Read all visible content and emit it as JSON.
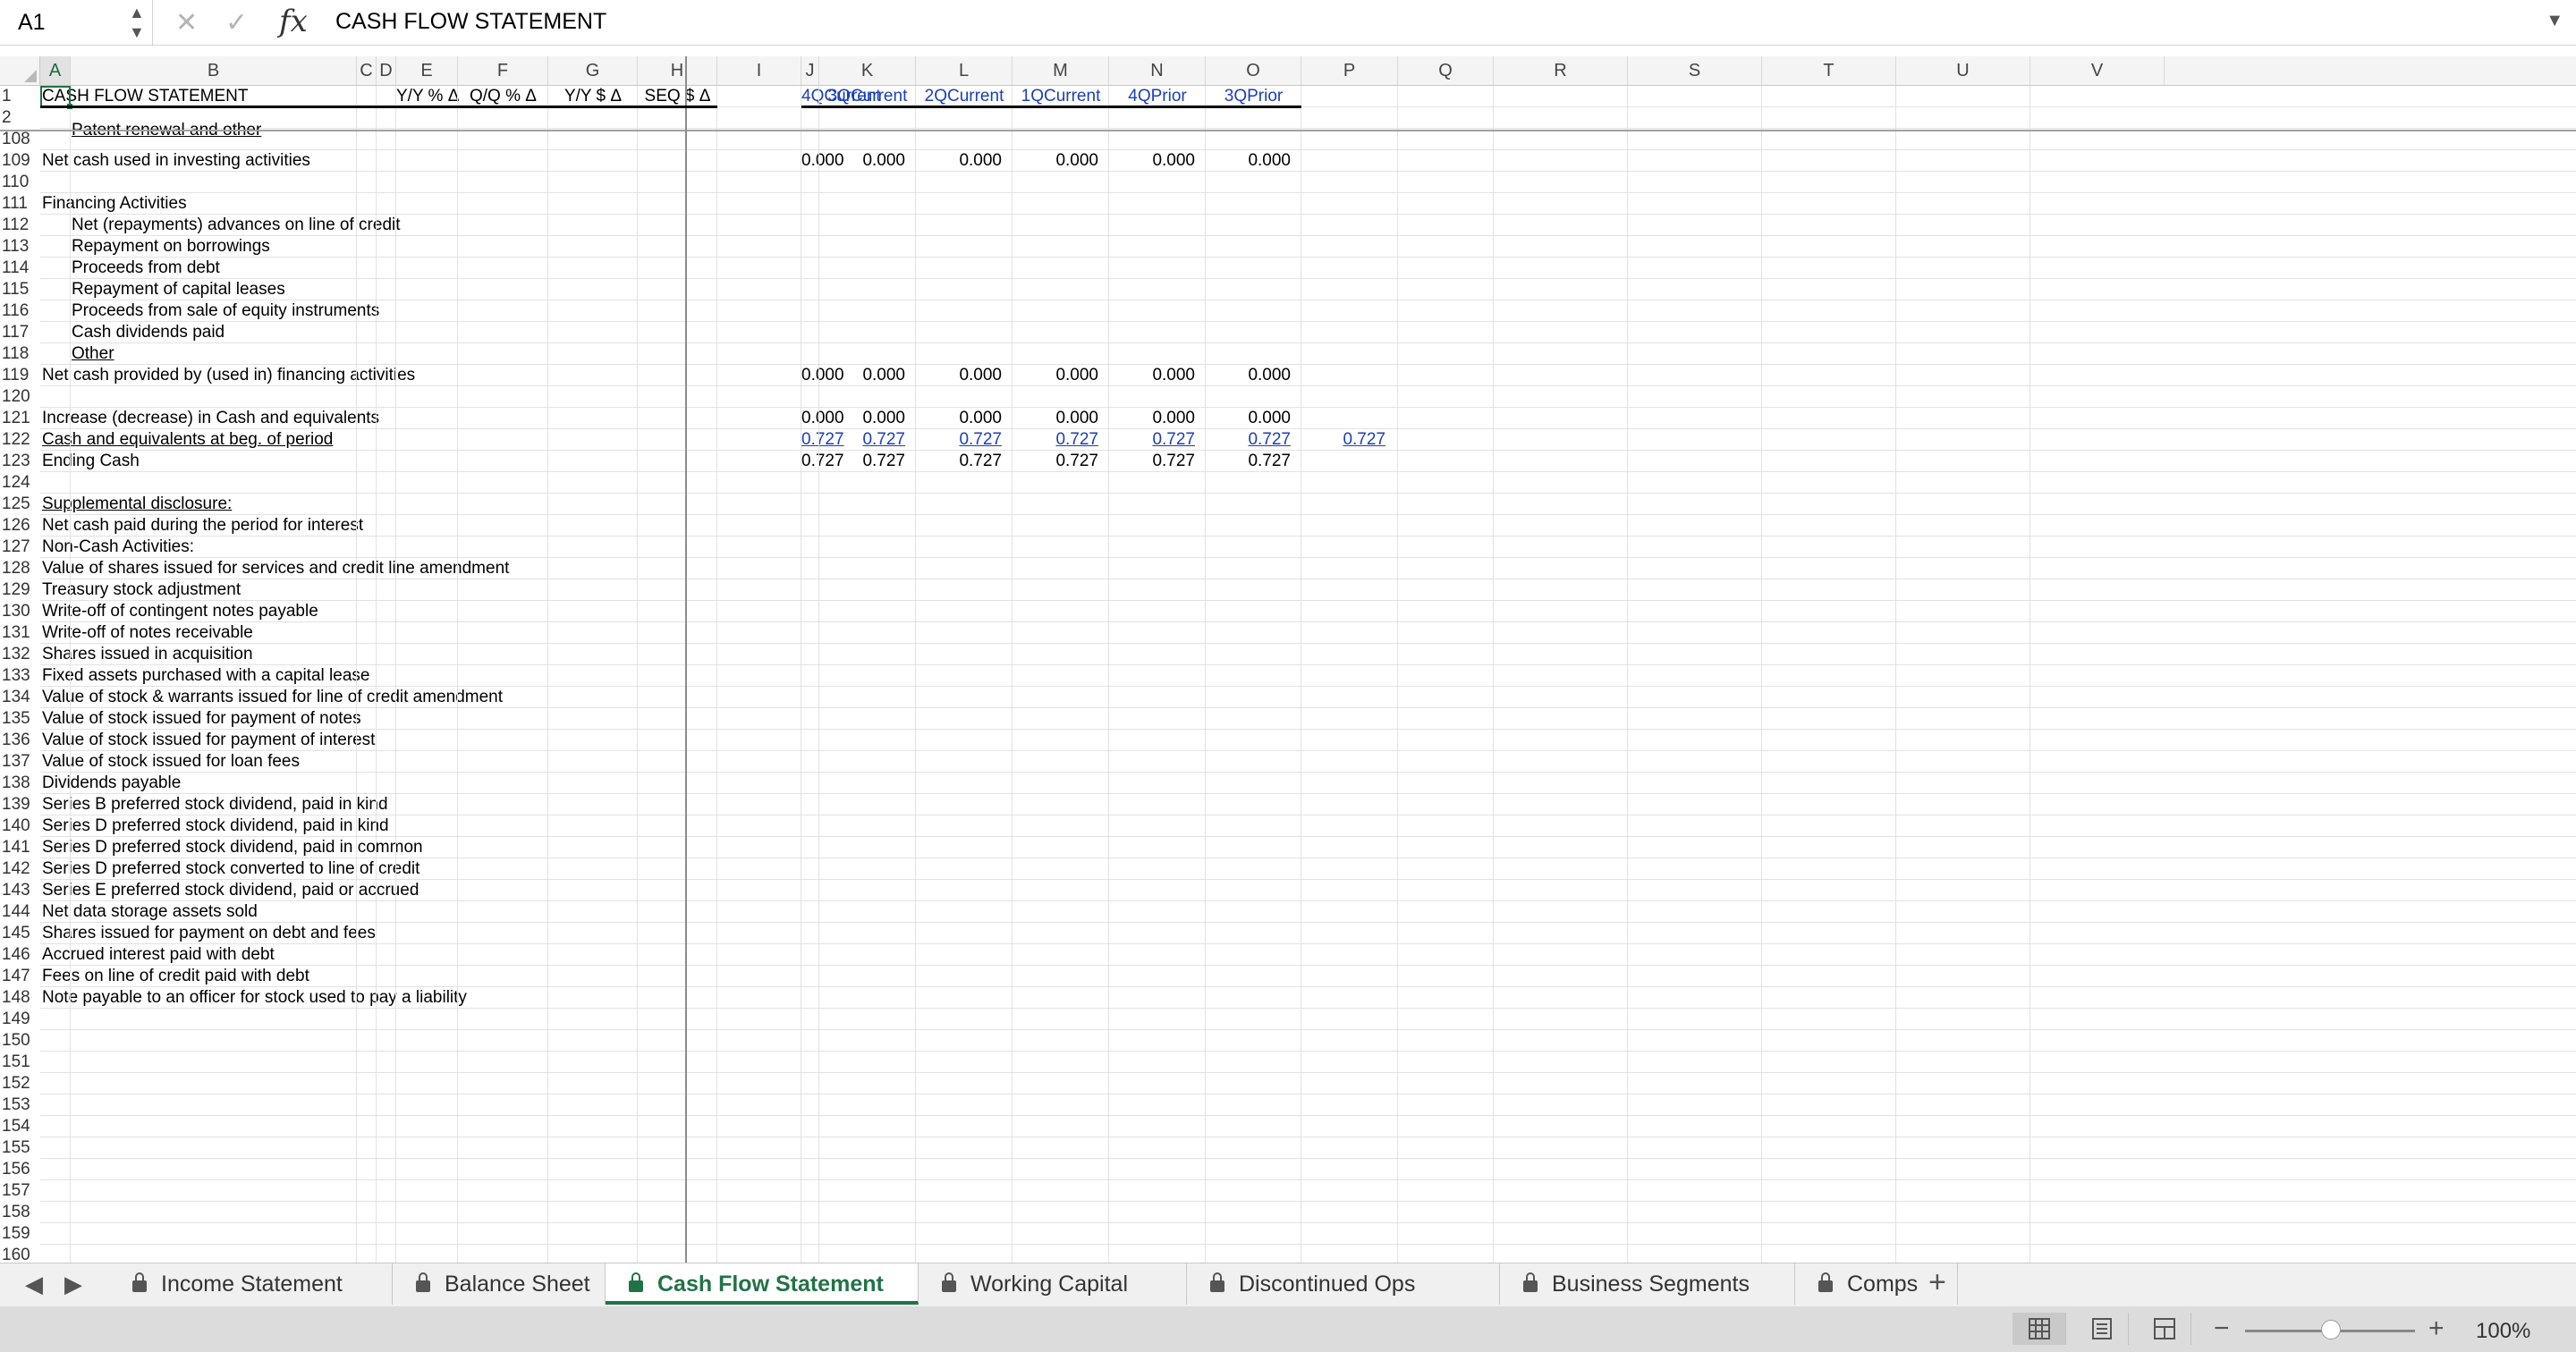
{
  "formula_bar": {
    "name_box": "A1",
    "fx": "fx",
    "formula": "CASH FLOW STATEMENT"
  },
  "column_headers": [
    "A",
    "B",
    "C",
    "D",
    "E",
    "F",
    "G",
    "H",
    "I",
    "J",
    "K",
    "L",
    "M",
    "N",
    "O",
    "P",
    "Q",
    "R",
    "S",
    "T",
    "U",
    "V"
  ],
  "header_row": {
    "title": "CASH FLOW STATEMENT",
    "e": "Y/Y % Δ",
    "f": "Q/Q % Δ",
    "g": "Y/Y $ Δ",
    "h": "SEQ $ Δ",
    "j": "4QCurrent",
    "k": "3QCurrent",
    "l": "2QCurrent",
    "m": "1QCurrent",
    "n": "4QPrior",
    "o": "3QPrior"
  },
  "rows": [
    {
      "n": "1",
      "label": ""
    },
    {
      "n": "2",
      "label": ""
    },
    {
      "n": "108",
      "label": "Patent renewal and other"
    },
    {
      "n": "109",
      "label": "Net cash used in investing activities",
      "vals": [
        "0.000",
        "0.000",
        "0.000",
        "0.000",
        "0.000",
        "0.000"
      ]
    },
    {
      "n": "110",
      "label": ""
    },
    {
      "n": "111",
      "label": "Financing Activities"
    },
    {
      "n": "112",
      "label": "Net (repayments) advances on line of credit",
      "indent": true
    },
    {
      "n": "113",
      "label": "Repayment on borrowings",
      "indent": true
    },
    {
      "n": "114",
      "label": "Proceeds from debt",
      "indent": true
    },
    {
      "n": "115",
      "label": "Repayment of capital leases",
      "indent": true
    },
    {
      "n": "116",
      "label": "Proceeds from sale of equity instruments",
      "indent": true
    },
    {
      "n": "117",
      "label": "Cash dividends paid",
      "indent": true
    },
    {
      "n": "118",
      "label": "Other",
      "indent": true,
      "underline": true
    },
    {
      "n": "119",
      "label": "Net cash provided by (used in) financing activities",
      "vals": [
        "0.000",
        "0.000",
        "0.000",
        "0.000",
        "0.000",
        "0.000"
      ]
    },
    {
      "n": "120",
      "label": ""
    },
    {
      "n": "121",
      "label": "Increase (decrease) in Cash and equivalents",
      "vals": [
        "0.000",
        "0.000",
        "0.000",
        "0.000",
        "0.000",
        "0.000"
      ]
    },
    {
      "n": "122",
      "label": "Cash and equivalents at beg. of period",
      "underline": true,
      "link": true,
      "vals": [
        "0.727",
        "0.727",
        "0.727",
        "0.727",
        "0.727",
        "0.727"
      ],
      "p": "0.727"
    },
    {
      "n": "123",
      "label": "Ending Cash",
      "vals": [
        "0.727",
        "0.727",
        "0.727",
        "0.727",
        "0.727",
        "0.727"
      ]
    },
    {
      "n": "124",
      "label": ""
    },
    {
      "n": "125",
      "label": "Supplemental disclosure:",
      "underline": true
    },
    {
      "n": "126",
      "label": "Net cash paid during the period for interest"
    },
    {
      "n": "127",
      "label": "Non-Cash Activities:"
    },
    {
      "n": "128",
      "label": "Value of shares issued for services and credit line amendment"
    },
    {
      "n": "129",
      "label": "Treasury stock adjustment"
    },
    {
      "n": "130",
      "label": "Write-off of contingent notes payable"
    },
    {
      "n": "131",
      "label": "Write-off of notes receivable"
    },
    {
      "n": "132",
      "label": "Shares issued in acquisition"
    },
    {
      "n": "133",
      "label": "Fixed assets purchased with a capital lease"
    },
    {
      "n": "134",
      "label": "Value of stock & warrants issued for line of credit amendment"
    },
    {
      "n": "135",
      "label": "Value of stock issued for payment of notes"
    },
    {
      "n": "136",
      "label": "Value of stock issued for payment of interest"
    },
    {
      "n": "137",
      "label": "Value of stock issued for loan fees"
    },
    {
      "n": "138",
      "label": "Dividends payable"
    },
    {
      "n": "139",
      "label": "Series B preferred stock dividend, paid in kind"
    },
    {
      "n": "140",
      "label": "Series D preferred stock dividend, paid in kind"
    },
    {
      "n": "141",
      "label": "Series D preferred stock dividend, paid in common"
    },
    {
      "n": "142",
      "label": "Series D preferred stock converted to line of credit"
    },
    {
      "n": "143",
      "label": "Series E preferred stock dividend, paid or accrued"
    },
    {
      "n": "144",
      "label": "Net data storage assets sold"
    },
    {
      "n": "145",
      "label": "Shares issued for payment on debt and fees"
    },
    {
      "n": "146",
      "label": "Accrued interest paid with debt"
    },
    {
      "n": "147",
      "label": "Fees on line of credit paid with debt"
    },
    {
      "n": "148",
      "label": "Note payable to an officer for stock used to pay a liability"
    },
    {
      "n": "149",
      "label": ""
    },
    {
      "n": "150",
      "label": ""
    },
    {
      "n": "151",
      "label": ""
    },
    {
      "n": "152",
      "label": ""
    },
    {
      "n": "153",
      "label": ""
    },
    {
      "n": "154",
      "label": ""
    },
    {
      "n": "155",
      "label": ""
    },
    {
      "n": "156",
      "label": ""
    },
    {
      "n": "157",
      "label": ""
    },
    {
      "n": "158",
      "label": ""
    },
    {
      "n": "159",
      "label": ""
    },
    {
      "n": "160",
      "label": ""
    }
  ],
  "sheet_tabs": [
    "Income Statement",
    "Balance Sheet",
    "Cash Flow Statement",
    "Working Capital",
    "Discontinued Ops",
    "Business Segments",
    "Comps"
  ],
  "active_tab": "Cash Flow Statement",
  "add_tab": "+",
  "zoom": {
    "minus": "−",
    "plus": "+",
    "percent": "100%",
    "level": 100
  },
  "colors": {
    "accent": "#217346",
    "link": "#1a3fb8"
  }
}
